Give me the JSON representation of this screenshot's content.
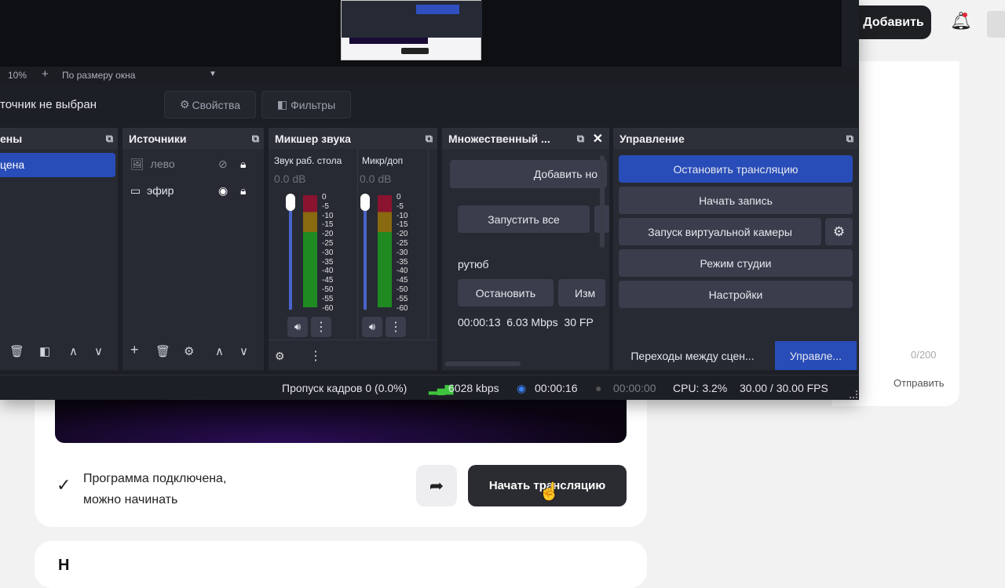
{
  "web": {
    "add_button": "Добавить",
    "status_line1": "Программа подключена,",
    "status_line2": "можно начинать",
    "start_stream": "Начать трансляцию",
    "next_card_title": "Н",
    "char_count": "0/200",
    "send": "Отправить"
  },
  "obs": {
    "zoom": {
      "percent": "10%",
      "plus": "+",
      "fit": "По размеру окна"
    },
    "source_bar": {
      "no_source": "точник не выбран",
      "properties": "Свойства",
      "filters": "Фильтры"
    },
    "scenes": {
      "title": "ены",
      "items": [
        "цена"
      ]
    },
    "sources": {
      "title": "Источники",
      "items": [
        {
          "name": "лево",
          "visible": false,
          "locked": true
        },
        {
          "name": "эфир",
          "visible": true,
          "locked": true
        }
      ]
    },
    "mixer": {
      "title": "Микшер звука",
      "channels": [
        {
          "name": "Звук раб. стола",
          "db": "0.0 dB"
        },
        {
          "name": "Микр/доп",
          "db": "0.0 dB"
        }
      ],
      "scale": [
        "0",
        "-5",
        "-10",
        "-15",
        "-20",
        "-25",
        "-30",
        "-35",
        "-40",
        "-45",
        "-50",
        "-55",
        "-60"
      ]
    },
    "multi": {
      "title": "Множественный ...",
      "add": "Добавить но",
      "start_all": "Запустить все",
      "target": "рутюб",
      "stop": "Остановить",
      "edit": "Изм",
      "stats": "00:00:13  6.03 Mbps  30 FP"
    },
    "controls": {
      "title": "Управление",
      "stop_stream": "Остановить трансляцию",
      "start_record": "Начать запись",
      "virtual_cam": "Запуск виртуальной камеры",
      "studio": "Режим студии",
      "settings": "Настройки",
      "tab_transitions": "Переходы между сцен...",
      "tab_controls": "Управле..."
    },
    "status": {
      "dropped": "Пропуск кадров 0 (0.0%)",
      "bitrate": "6028 kbps",
      "stream_time": "00:00:16",
      "rec_time": "00:00:00",
      "cpu": "CPU: 3.2%",
      "fps": "30.00 / 30.00 FPS"
    },
    "colors": {
      "accent": "#284cb8",
      "bg": "#1d1f26"
    }
  }
}
